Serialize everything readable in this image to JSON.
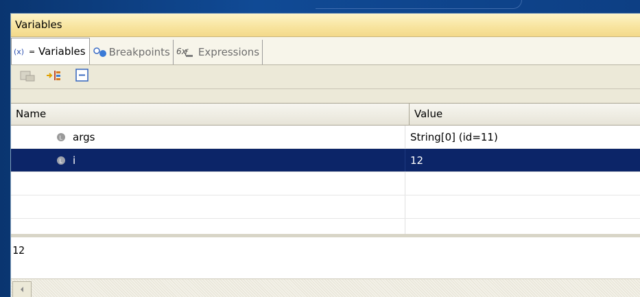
{
  "view": {
    "title": "Variables"
  },
  "tabs": [
    {
      "label": "Variables",
      "icon": "variables-icon",
      "active": true
    },
    {
      "label": "Breakpoints",
      "icon": "breakpoints-icon",
      "active": false
    },
    {
      "label": "Expressions",
      "icon": "expressions-icon",
      "active": false
    }
  ],
  "tab_variables_prefix": "(x)=",
  "toolbar": {
    "buttons": [
      "show-type-names-icon",
      "show-logical-structure-icon",
      "collapse-all-icon"
    ]
  },
  "table": {
    "columns": [
      "Name",
      "Value"
    ],
    "rows": [
      {
        "name": "args",
        "value": "String[0]  (id=11)",
        "selected": false
      },
      {
        "name": "i",
        "value": "12",
        "selected": true
      }
    ]
  },
  "detail": {
    "text": "12"
  },
  "colors": {
    "selection": "#0c2568",
    "title_bar": "#f8e5a0",
    "desktop": "#0b3a78"
  }
}
